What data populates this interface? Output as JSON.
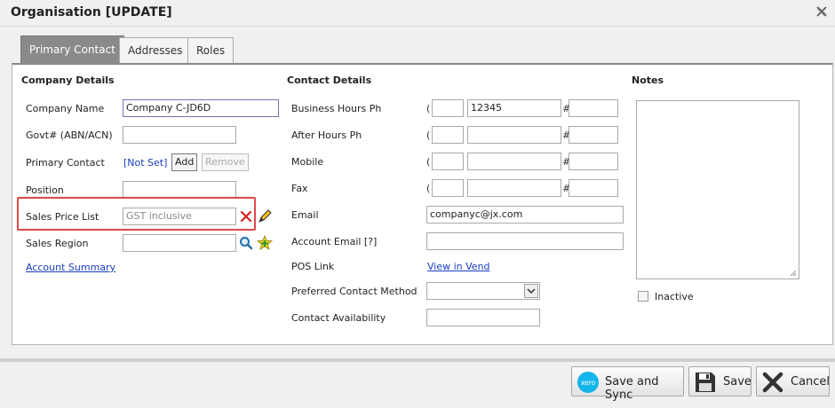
{
  "window": {
    "title": "Organisation [UPDATE]",
    "close_icon": "close-x-icon"
  },
  "tabs": [
    {
      "label": "Primary Contact",
      "active": true
    },
    {
      "label": "Addresses",
      "active": false
    },
    {
      "label": "Roles",
      "active": false
    }
  ],
  "company": {
    "heading": "Company Details",
    "name_label": "Company Name",
    "name_value": "Company C-JD6D",
    "govt_label": "Govt# (ABN/ACN)",
    "govt_value": "",
    "primary_contact_label": "Primary Contact",
    "primary_contact_value": "[Not Set]",
    "add_label": "Add",
    "remove_label": "Remove",
    "position_label": "Position",
    "position_value": "",
    "sales_price_list_label": "Sales Price List",
    "sales_price_list_value": "GST inclusive",
    "sales_region_label": "Sales Region",
    "sales_region_value": "",
    "account_summary_link": "Account Summary"
  },
  "contact": {
    "heading": "Contact Details",
    "business_label": "Business Hours Ph",
    "business_area": "",
    "business_number": "12345",
    "business_ext": "",
    "after_label": "After Hours Ph",
    "mobile_label": "Mobile",
    "fax_label": "Fax",
    "open_paren": "(",
    "hash": "#",
    "email_label": "Email",
    "email_value": "companyc@jx.com",
    "account_email_label": "Account Email [?]",
    "account_email_value": "",
    "pos_label": "POS Link",
    "pos_link": "View in Vend",
    "preferred_label": "Preferred Contact Method",
    "preferred_value": "",
    "availability_label": "Contact Availability",
    "availability_value": ""
  },
  "notes": {
    "heading": "Notes",
    "value": "",
    "inactive_label": "Inactive",
    "inactive_checked": false
  },
  "footer": {
    "save_sync_label": "Save and Sync",
    "xero_icon_text": "xero",
    "save_label": "Save",
    "cancel_label": "Cancel"
  },
  "colors": {
    "active_tab": "#8a8a8a",
    "link": "#1a3dbf",
    "highlight": "#e04848",
    "xero": "#13b5ea"
  }
}
